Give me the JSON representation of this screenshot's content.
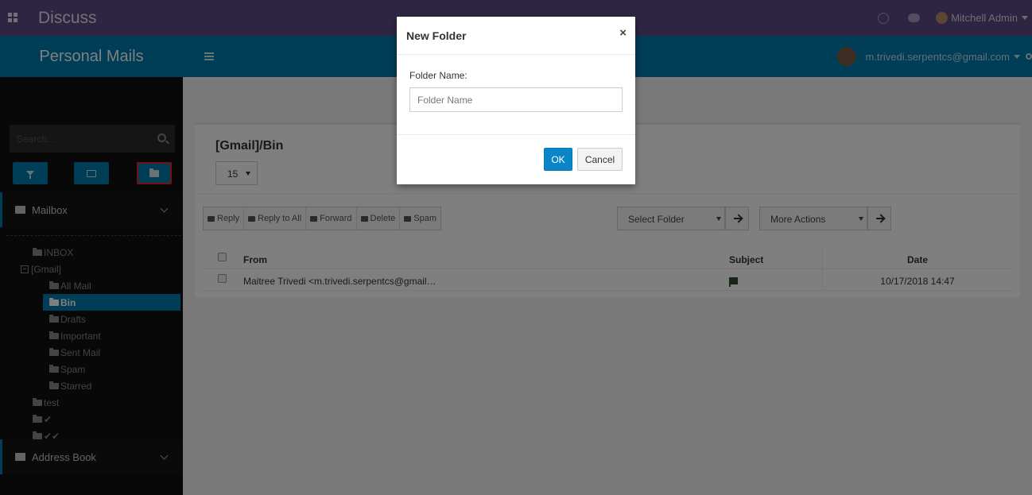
{
  "topbar": {
    "title": "Discuss",
    "user": "Mitchell Admin"
  },
  "sidebar": {
    "header": "Personal Mails",
    "search_placeholder": "Search...",
    "sections": [
      {
        "label": "Mailbox"
      },
      {
        "label": "Address Book"
      }
    ],
    "tree": [
      {
        "label": "INBOX"
      },
      {
        "label": "[Gmail]"
      },
      {
        "label": "All Mail"
      },
      {
        "label": "Bin"
      },
      {
        "label": "Drafts"
      },
      {
        "label": "Important"
      },
      {
        "label": "Sent Mail"
      },
      {
        "label": "Spam"
      },
      {
        "label": "Starred"
      },
      {
        "label": "test"
      },
      {
        "label": "✔"
      },
      {
        "label": "✔✔"
      }
    ]
  },
  "header": {
    "account": "m.trivedi.serpentcs@gmail.com"
  },
  "main": {
    "title": "[Gmail]/Bin",
    "page_size": "15",
    "toolbar": [
      "Reply",
      "Reply to All",
      "Forward",
      "Delete",
      "Spam"
    ],
    "select_folder": "Select Folder",
    "more_actions": "More Actions",
    "columns": {
      "from": "From",
      "subject": "Subject",
      "date": "Date"
    },
    "rows": [
      {
        "from": "Maitree Trivedi <m.trivedi.serpentcs@gmail…",
        "date": "10/17/2018 14:47"
      }
    ]
  },
  "modal": {
    "title": "New Folder",
    "close": "×",
    "label": "Folder Name:",
    "placeholder": "Folder Name",
    "ok": "OK",
    "cancel": "Cancel"
  },
  "colors": {
    "topbar": "#5d4a87",
    "accent": "#007aaf",
    "sidebar": "#101010",
    "highlight": "#e22222"
  }
}
